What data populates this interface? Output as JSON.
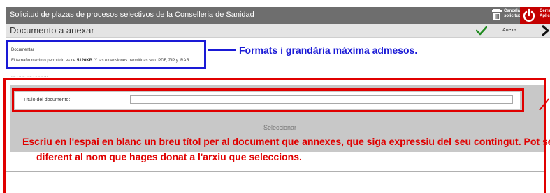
{
  "header": {
    "title": "Solicitud de plazas de procesos selectivos de la Conselleria de Sanidad",
    "cancel_label": "Cancela solicitud",
    "exit_label": "Cerrar Aplicación",
    "colors": {
      "bar": "#6e6e6e",
      "exit": "#c40000"
    }
  },
  "subheader": {
    "title": "Documento a anexar",
    "annex_label": "Anexa",
    "icons": [
      "check-icon",
      "next-arrow-icon"
    ]
  },
  "info": {
    "section_label": "Documentar",
    "text_prefix": "El tamaño máximo permitido es de ",
    "max_size": "5120KB",
    "text_suffix": ". Y las extensiones permitidas son .PDF, ZIP y .RAR."
  },
  "source_label": "Desde mi equipo",
  "form": {
    "title_label": "Título del documento:",
    "title_value": "",
    "select_label": "Seleccionar"
  },
  "annotations": {
    "blue_caption": "Formats i grandària màxima admesos.",
    "red_caption": "Escriu en l'espai en blanc un breu títol per al document que annexes, que siga expressiu del seu contingut. Pot ser diferent al nom que hages donat a l'arxiu que seleccions.",
    "colors": {
      "blue": "#1a1ad6",
      "red": "#e00000"
    }
  }
}
